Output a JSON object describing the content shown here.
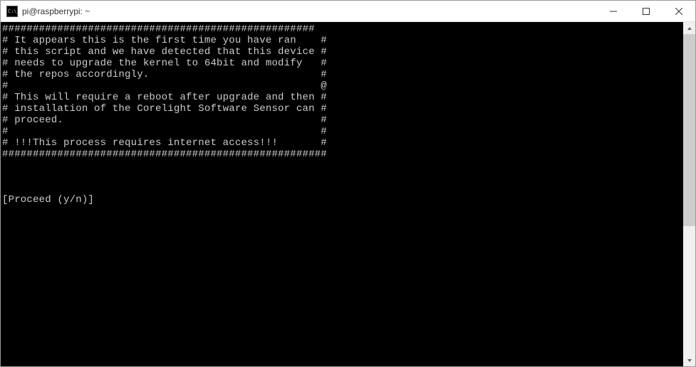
{
  "window": {
    "title": "pi@raspberrypi: ~"
  },
  "terminal": {
    "lines": [
      "###################################################",
      "# It appears this is the first time you have ran    #",
      "# this script and we have detected that this device #",
      "# needs to upgrade the kernel to 64bit and modify   #",
      "# the repos accordingly.                            #",
      "#                                                   @",
      "# This will require a reboot after upgrade and then #",
      "# installation of the Corelight Software Sensor can #",
      "# proceed.                                          #",
      "#                                                   #",
      "# !!!This process requires internet access!!!       #",
      "#####################################################",
      "",
      "",
      "",
      "[Proceed (y/n)]"
    ]
  }
}
